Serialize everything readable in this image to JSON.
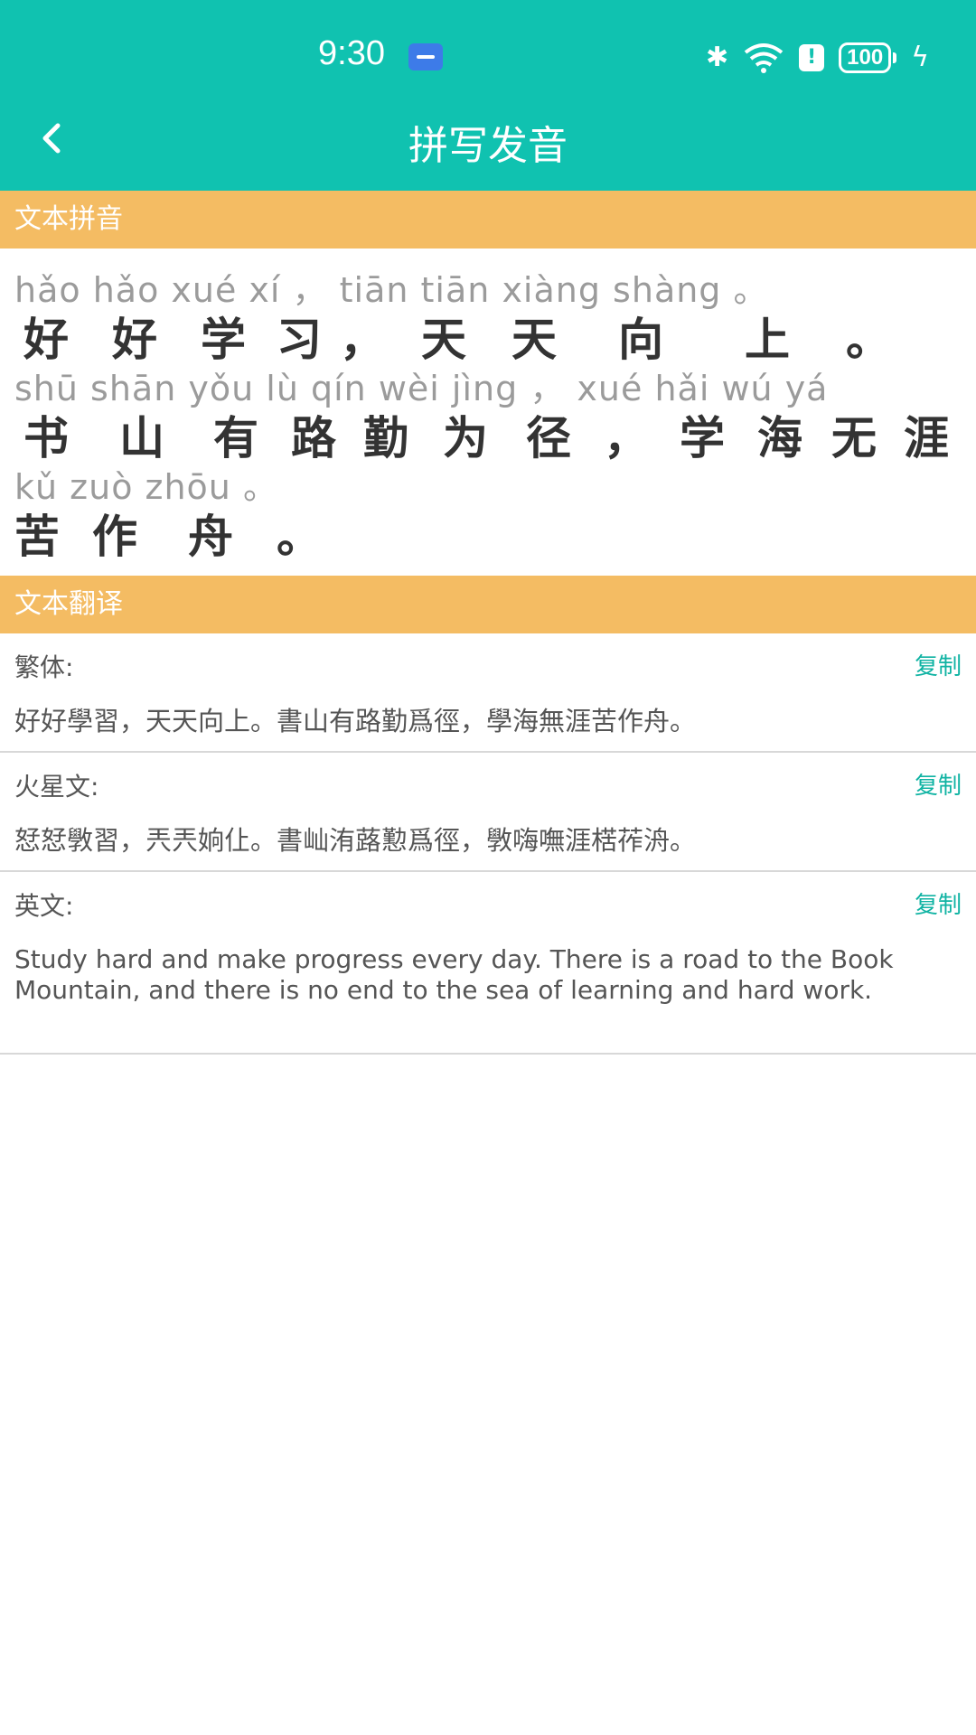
{
  "status": {
    "time": "9:30",
    "battery": "100"
  },
  "header": {
    "title": "拼写发音"
  },
  "pinyin_section": {
    "header": "文本拼音",
    "lines": [
      {
        "pinyin": "hǎo hǎo xué  xí   ，   tiān tiān xiàng shàng  。",
        "chars": [
          "好",
          "好",
          "学",
          "习",
          "，",
          "天",
          "天",
          "向",
          "上",
          "。"
        ]
      },
      {
        "pinyin": "shū shān yǒu  lù  qín wèi jìng  ，   xué hǎi wú  yá",
        "chars": [
          "书",
          "山",
          "有",
          "路",
          "勤",
          "为",
          "径",
          "，",
          "学",
          "海",
          "无",
          "涯"
        ]
      },
      {
        "pinyin": "kǔ zuò zhōu  。",
        "chars": [
          "苦",
          "作",
          "舟",
          "。"
        ]
      }
    ]
  },
  "translation_section": {
    "header": "文本翻译",
    "copy_label": "复制",
    "items": [
      {
        "label": "繁体:",
        "text": "好好學習，天天向上。書山有路勤爲徑，學海無涯苦作舟。"
      },
      {
        "label": "火星文:",
        "text": "恏恏斆習，兲兲姠仩。書屾洧蕗懃爲徑，斆嗨嘸涯楛莋洀。"
      },
      {
        "label": "英文:",
        "text": "Study hard and make progress every day. There is a road to the Book Mountain, and there is no end to the sea of learning and hard work."
      }
    ]
  }
}
